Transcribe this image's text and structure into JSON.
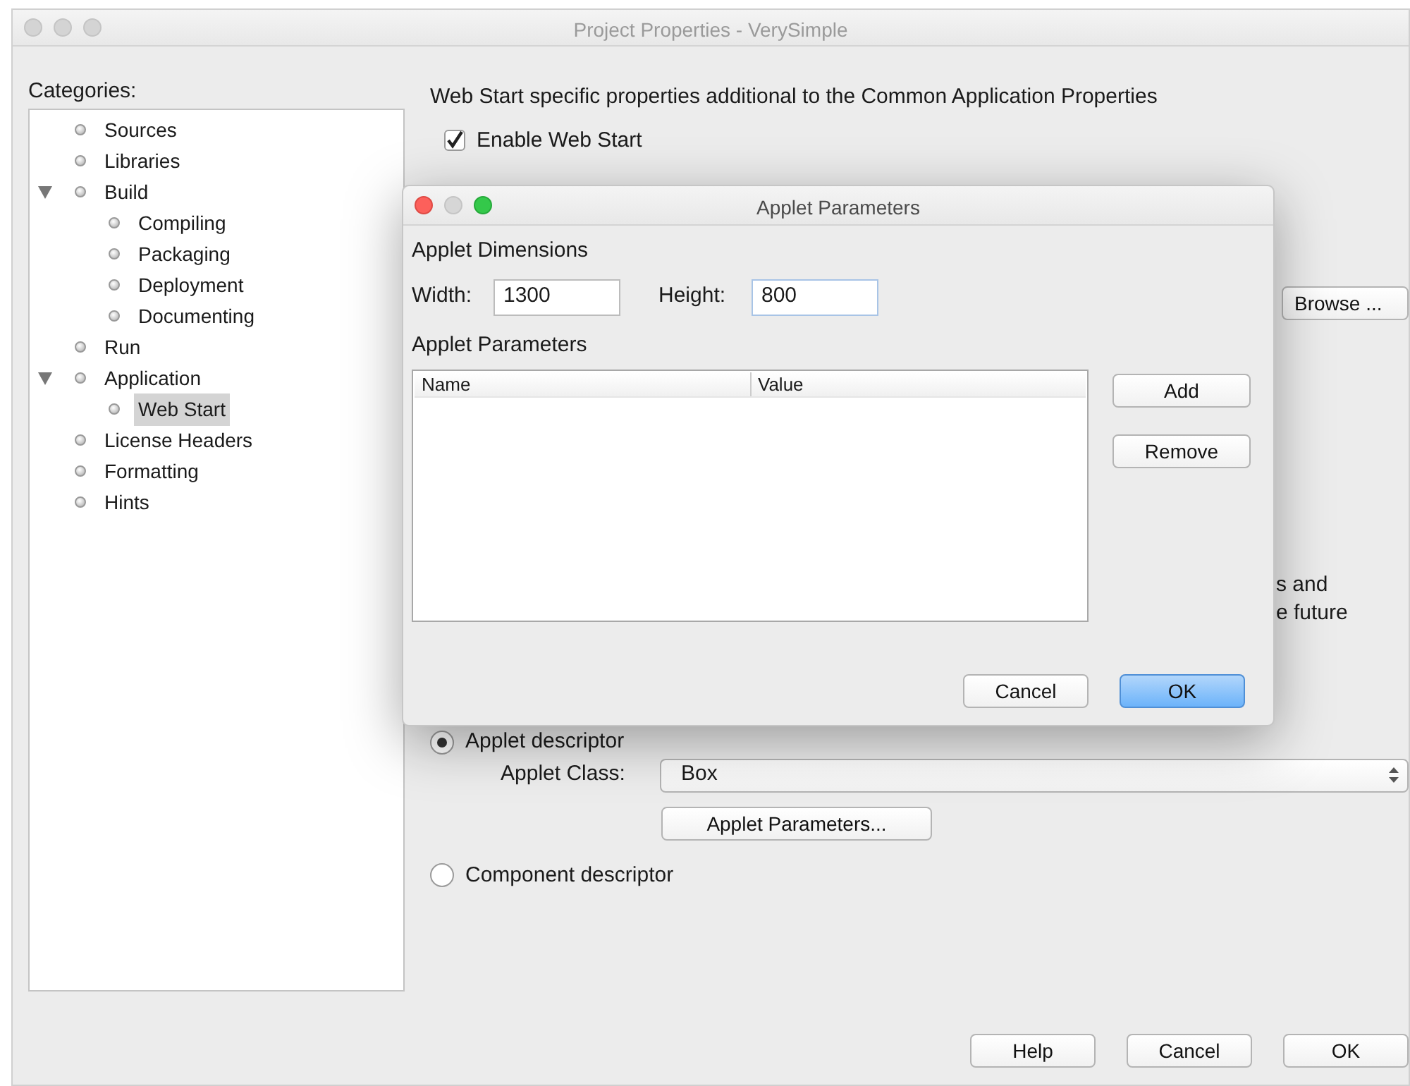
{
  "window": {
    "title": "Project Properties - VerySimple"
  },
  "categories": {
    "label": "Categories:",
    "items": [
      {
        "label": "Sources",
        "selected": false
      },
      {
        "label": "Libraries",
        "selected": false
      },
      {
        "label": "Build",
        "selected": false,
        "expanded": true,
        "children": [
          {
            "label": "Compiling",
            "selected": false
          },
          {
            "label": "Packaging",
            "selected": false
          },
          {
            "label": "Deployment",
            "selected": false
          },
          {
            "label": "Documenting",
            "selected": false
          }
        ]
      },
      {
        "label": "Run",
        "selected": false
      },
      {
        "label": "Application",
        "selected": false,
        "expanded": true,
        "children": [
          {
            "label": "Web Start",
            "selected": true
          }
        ]
      },
      {
        "label": "License Headers",
        "selected": false
      },
      {
        "label": "Formatting",
        "selected": false
      },
      {
        "label": "Hints",
        "selected": false
      }
    ]
  },
  "web_start": {
    "heading": "Web Start specific properties additional to the Common Application Properties",
    "enable": {
      "label": "Enable Web Start",
      "checked": true
    },
    "browse_button": "Browse ...",
    "partial_text_lines": [
      "s and",
      "e future"
    ],
    "descriptors": [
      {
        "label": "Applet descriptor",
        "selected": true
      },
      {
        "label": "Component descriptor",
        "selected": false
      }
    ],
    "applet_class": {
      "label": "Applet Class:",
      "value": "Box"
    },
    "applet_parameters_button": "Applet Parameters..."
  },
  "buttons": [
    "Help",
    "Cancel",
    "OK"
  ],
  "dialog": {
    "title": "Applet Parameters",
    "dimensions_label": "Applet Dimensions",
    "width": {
      "label": "Width:",
      "value": "1300"
    },
    "height": {
      "label": "Height:",
      "value": "800"
    },
    "parameters_label": "Applet Parameters",
    "table": {
      "columns": [
        "Name",
        "Value"
      ]
    },
    "side_buttons": [
      "Add",
      "Remove"
    ],
    "buttons": [
      {
        "label": "Cancel",
        "default": false
      },
      {
        "label": "OK",
        "default": true
      }
    ]
  }
}
